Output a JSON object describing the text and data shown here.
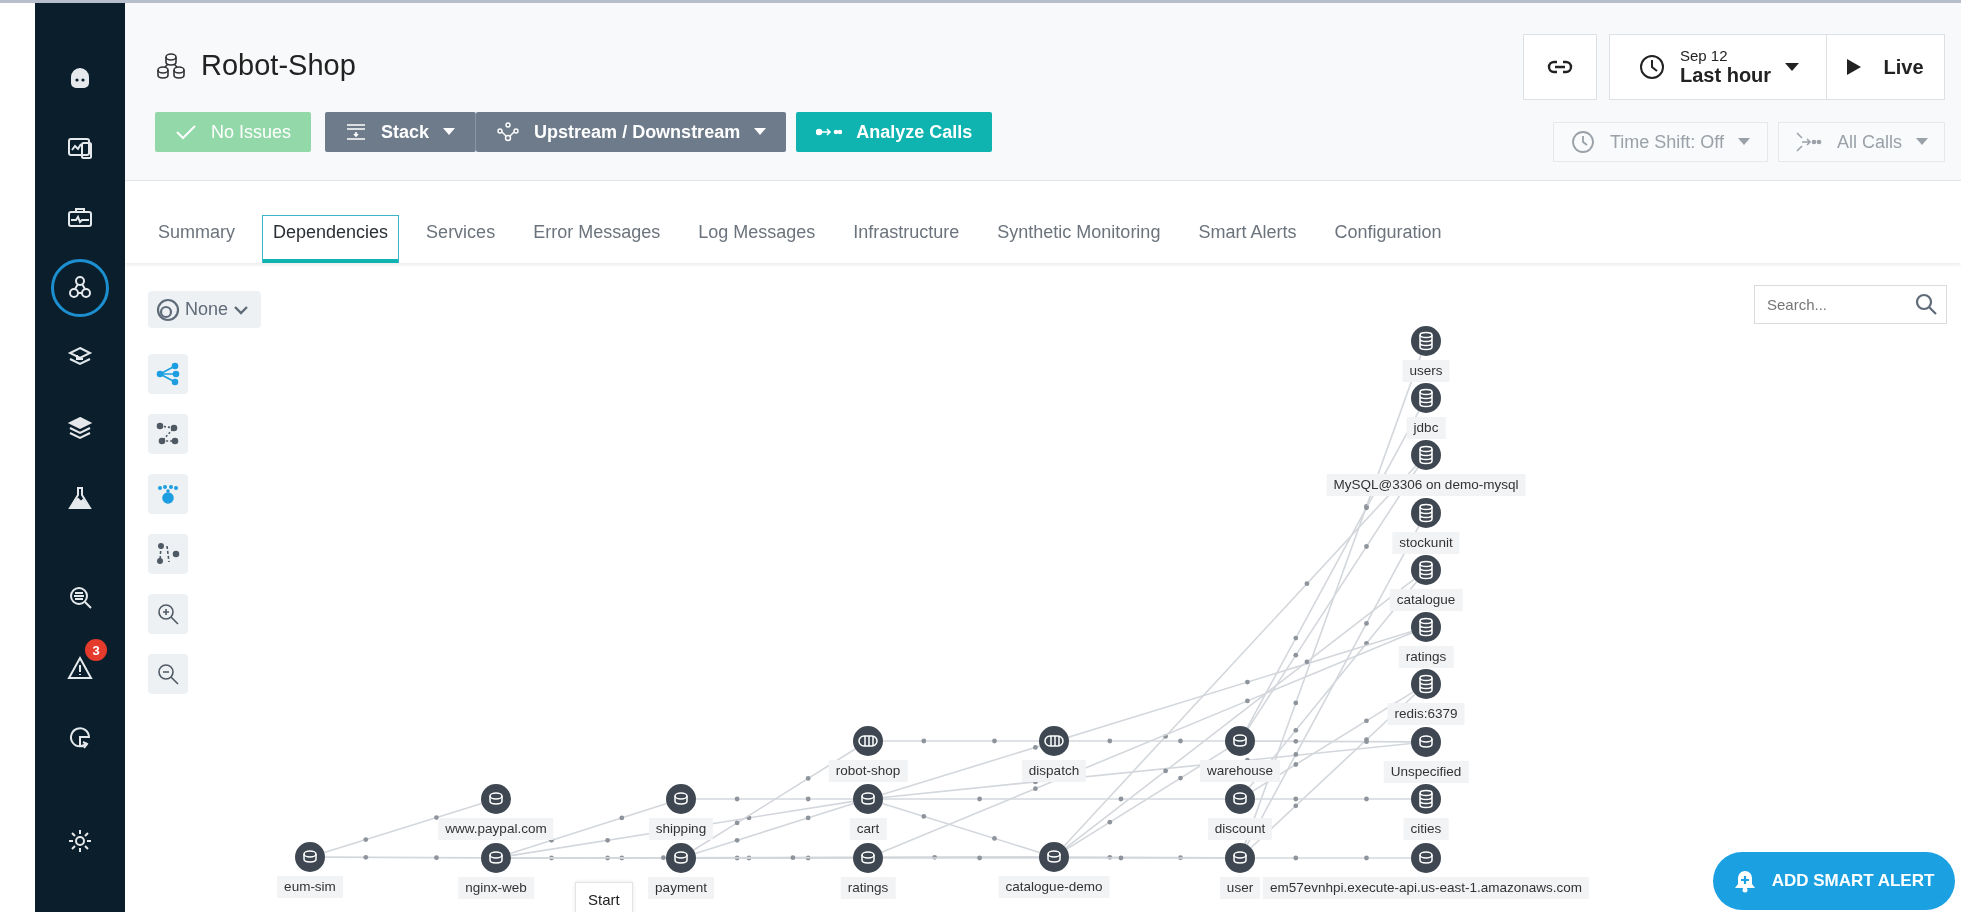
{
  "sidebar": {
    "items": [
      {
        "kind": "logo",
        "selected": false
      },
      {
        "kind": "dashboards",
        "selected": false
      },
      {
        "kind": "websites",
        "selected": false
      },
      {
        "kind": "applications",
        "selected": true
      },
      {
        "kind": "platforms",
        "selected": false
      },
      {
        "kind": "infrastructure",
        "selected": false
      },
      {
        "kind": "synthetics",
        "selected": false
      },
      {
        "kind": "analytics",
        "selected": false
      },
      {
        "kind": "events",
        "selected": false,
        "badge": "3"
      },
      {
        "kind": "automation",
        "selected": false
      },
      {
        "kind": "settings",
        "selected": false
      }
    ]
  },
  "header": {
    "title": "Robot-Shop",
    "buttons": [
      {
        "kind": "status",
        "label": "No Issues"
      },
      {
        "kind": "stack",
        "label": "Stack"
      },
      {
        "kind": "upstream",
        "label": "Upstream / Downstream"
      },
      {
        "kind": "analyze",
        "label": "Analyze Calls"
      }
    ],
    "time": {
      "date": "Sep 12",
      "range": "Last hour"
    },
    "live": "Live",
    "time_shift": {
      "label": "Time Shift: Off",
      "disabled": true
    },
    "all_calls": {
      "label": "All Calls",
      "disabled": true
    }
  },
  "tabs": [
    {
      "label": "Summary",
      "selected": false
    },
    {
      "label": "Dependencies",
      "selected": true
    },
    {
      "label": "Services",
      "selected": false
    },
    {
      "label": "Error Messages",
      "selected": false
    },
    {
      "label": "Log Messages",
      "selected": false
    },
    {
      "label": "Infrastructure",
      "selected": false
    },
    {
      "label": "Synthetic Monitoring",
      "selected": false
    },
    {
      "label": "Smart Alerts",
      "selected": false
    },
    {
      "label": "Configuration",
      "selected": false
    }
  ],
  "canvas": {
    "group_by": "None",
    "tools": [
      {
        "kind": "layout",
        "on": true
      },
      {
        "kind": "graph",
        "on": false
      },
      {
        "kind": "focus",
        "on": true
      },
      {
        "kind": "path",
        "on": false
      },
      {
        "kind": "zoom-in",
        "on": false
      },
      {
        "kind": "zoom-out",
        "on": false
      }
    ],
    "search": {
      "placeholder": "Search..."
    },
    "nodes": [
      {
        "label": "eum-sim",
        "kind": "service"
      },
      {
        "label": "www.paypal.com",
        "kind": "service"
      },
      {
        "label": "nginx-web",
        "kind": "service"
      },
      {
        "label": "shipping",
        "kind": "service"
      },
      {
        "label": "payment",
        "kind": "service"
      },
      {
        "label": "robot-shop",
        "kind": "queue"
      },
      {
        "label": "cart",
        "kind": "service"
      },
      {
        "label": "ratings",
        "kind": "service"
      },
      {
        "label": "dispatch",
        "kind": "queue"
      },
      {
        "label": "catalogue-demo",
        "kind": "service"
      },
      {
        "label": "warehouse",
        "kind": "service"
      },
      {
        "label": "discount",
        "kind": "service"
      },
      {
        "label": "user",
        "kind": "service"
      },
      {
        "label": "users",
        "kind": "database"
      },
      {
        "label": "jdbc",
        "kind": "database"
      },
      {
        "label": "MySQL@3306 on demo-mysql",
        "kind": "database"
      },
      {
        "label": "stockunit",
        "kind": "database"
      },
      {
        "label": "catalogue",
        "kind": "database"
      },
      {
        "label": "ratings",
        "kind": "database"
      },
      {
        "label": "redis:6379",
        "kind": "database"
      },
      {
        "label": "Unspecified",
        "kind": "service"
      },
      {
        "label": "cities",
        "kind": "database"
      },
      {
        "label": "em57evnhpi.execute-api.us-east-1.amazonaws.com",
        "kind": "service"
      }
    ],
    "tooltip": "Start",
    "add_alert": "ADD SMART ALERT"
  }
}
